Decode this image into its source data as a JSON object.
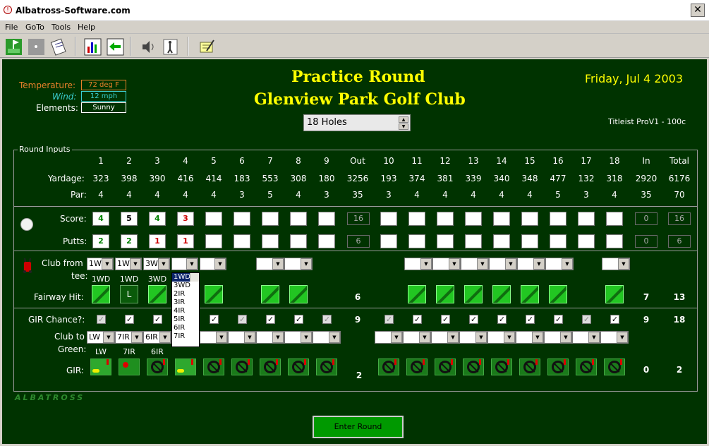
{
  "window": {
    "title": "Albatross-Software.com",
    "close": "✕"
  },
  "menu": [
    "File",
    "GoTo",
    "Tools",
    "Help"
  ],
  "weather": {
    "temp_label": "Temperature:",
    "temp": "72 deg F",
    "wind_label": "Wind:",
    "wind": "12 mph",
    "elements_label": "Elements:",
    "elements": "Sunny"
  },
  "header": {
    "title": "Practice Round",
    "course": "Glenview Park Golf Club",
    "date": "Friday, Jul 4 2003",
    "holes": "18 Holes",
    "ball": "Titleist ProV1 - 100c"
  },
  "section_label": "Round Inputs",
  "row_labels": {
    "yardage": "Yardage:",
    "par": "Par:",
    "score": "Score:",
    "putts": "Putts:",
    "club_from": "Club from",
    "tee": "tee:",
    "fairway": "Fairway Hit:",
    "gir_chance": "GIR Chance?:",
    "club_to": "Club to",
    "green": "Green:",
    "gir": "GIR:"
  },
  "holes": [
    "1",
    "2",
    "3",
    "4",
    "5",
    "6",
    "7",
    "8",
    "9",
    "Out",
    "10",
    "11",
    "12",
    "13",
    "14",
    "15",
    "16",
    "17",
    "18",
    "In",
    "Total"
  ],
  "yardage": [
    "323",
    "398",
    "390",
    "416",
    "414",
    "183",
    "553",
    "308",
    "180",
    "3256",
    "193",
    "374",
    "381",
    "339",
    "340",
    "348",
    "477",
    "132",
    "318",
    "2920",
    "6176"
  ],
  "par": [
    "4",
    "4",
    "4",
    "4",
    "4",
    "3",
    "5",
    "4",
    "3",
    "35",
    "3",
    "4",
    "4",
    "4",
    "4",
    "4",
    "5",
    "3",
    "4",
    "35",
    "70"
  ],
  "scores": [
    "4",
    "5",
    "4",
    "3",
    "",
    "",
    "",
    "",
    "",
    "",
    "",
    "",
    "",
    "",
    "",
    "",
    "",
    "",
    ""
  ],
  "score_colors": [
    "#008000",
    "#000000",
    "#008000",
    "#cc0000"
  ],
  "putts": [
    "2",
    "2",
    "1",
    "1",
    "",
    "",
    "",
    "",
    "",
    "",
    "",
    "",
    "",
    "",
    "",
    "",
    "",
    "",
    ""
  ],
  "putt_colors": [
    "#008000",
    "#008000",
    "#cc0000",
    "#cc0000"
  ],
  "score_totals": {
    "out": "16",
    "in": "0",
    "total": "16"
  },
  "putt_totals": {
    "out": "6",
    "in": "0",
    "total": "6"
  },
  "tee_clubs": [
    "1W",
    "1W",
    "3W"
  ],
  "tee_clubs_shown": [
    "1WD",
    "1WD",
    "3WD"
  ],
  "fairway_letter": "L",
  "fairway_totals": {
    "out": "6",
    "in": "7",
    "total": "13"
  },
  "gir_chance_totals": {
    "out": "9",
    "in": "9",
    "total": "18"
  },
  "green_clubs": [
    "LW",
    "7IR",
    "6IR"
  ],
  "green_clubs_shown": [
    "LW",
    "7IR",
    "6IR"
  ],
  "gir_totals": {
    "out": "2",
    "in": "0",
    "total": "2"
  },
  "dropdown_options": [
    "1WD",
    "3WD",
    "2IR",
    "3IR",
    "4IR",
    "5IR",
    "6IR",
    "7IR"
  ],
  "brand": "ALBATROSS",
  "enter_button": "Enter Round"
}
